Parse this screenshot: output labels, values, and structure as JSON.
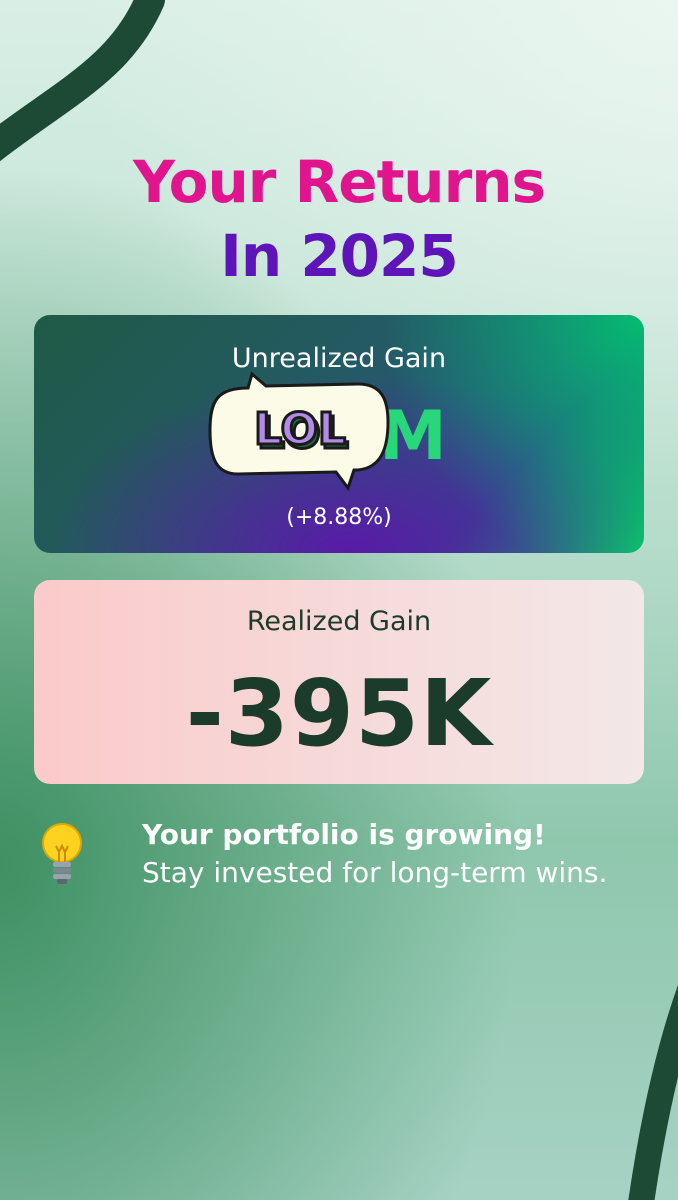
{
  "header": {
    "title_line1": "Your Returns",
    "title_line2": "In 2025"
  },
  "unrealized": {
    "label": "Unrealized Gain",
    "value_visible": "M",
    "percent": "(+8.88%)"
  },
  "sticker": {
    "text": "LOL",
    "icon": "speech-bubble-sticker"
  },
  "realized": {
    "label": "Realized Gain",
    "value": "-395K"
  },
  "tip": {
    "icon": "light-bulb-icon",
    "headline": "Your portfolio is growing!",
    "body": "Stay invested for long-term wins."
  },
  "colors": {
    "title_pink": "#e0148c",
    "title_purple": "#5d14b8",
    "gain_green": "#28d77a",
    "realized_text": "#1b3c2b",
    "stripe": "#1d4a34"
  }
}
